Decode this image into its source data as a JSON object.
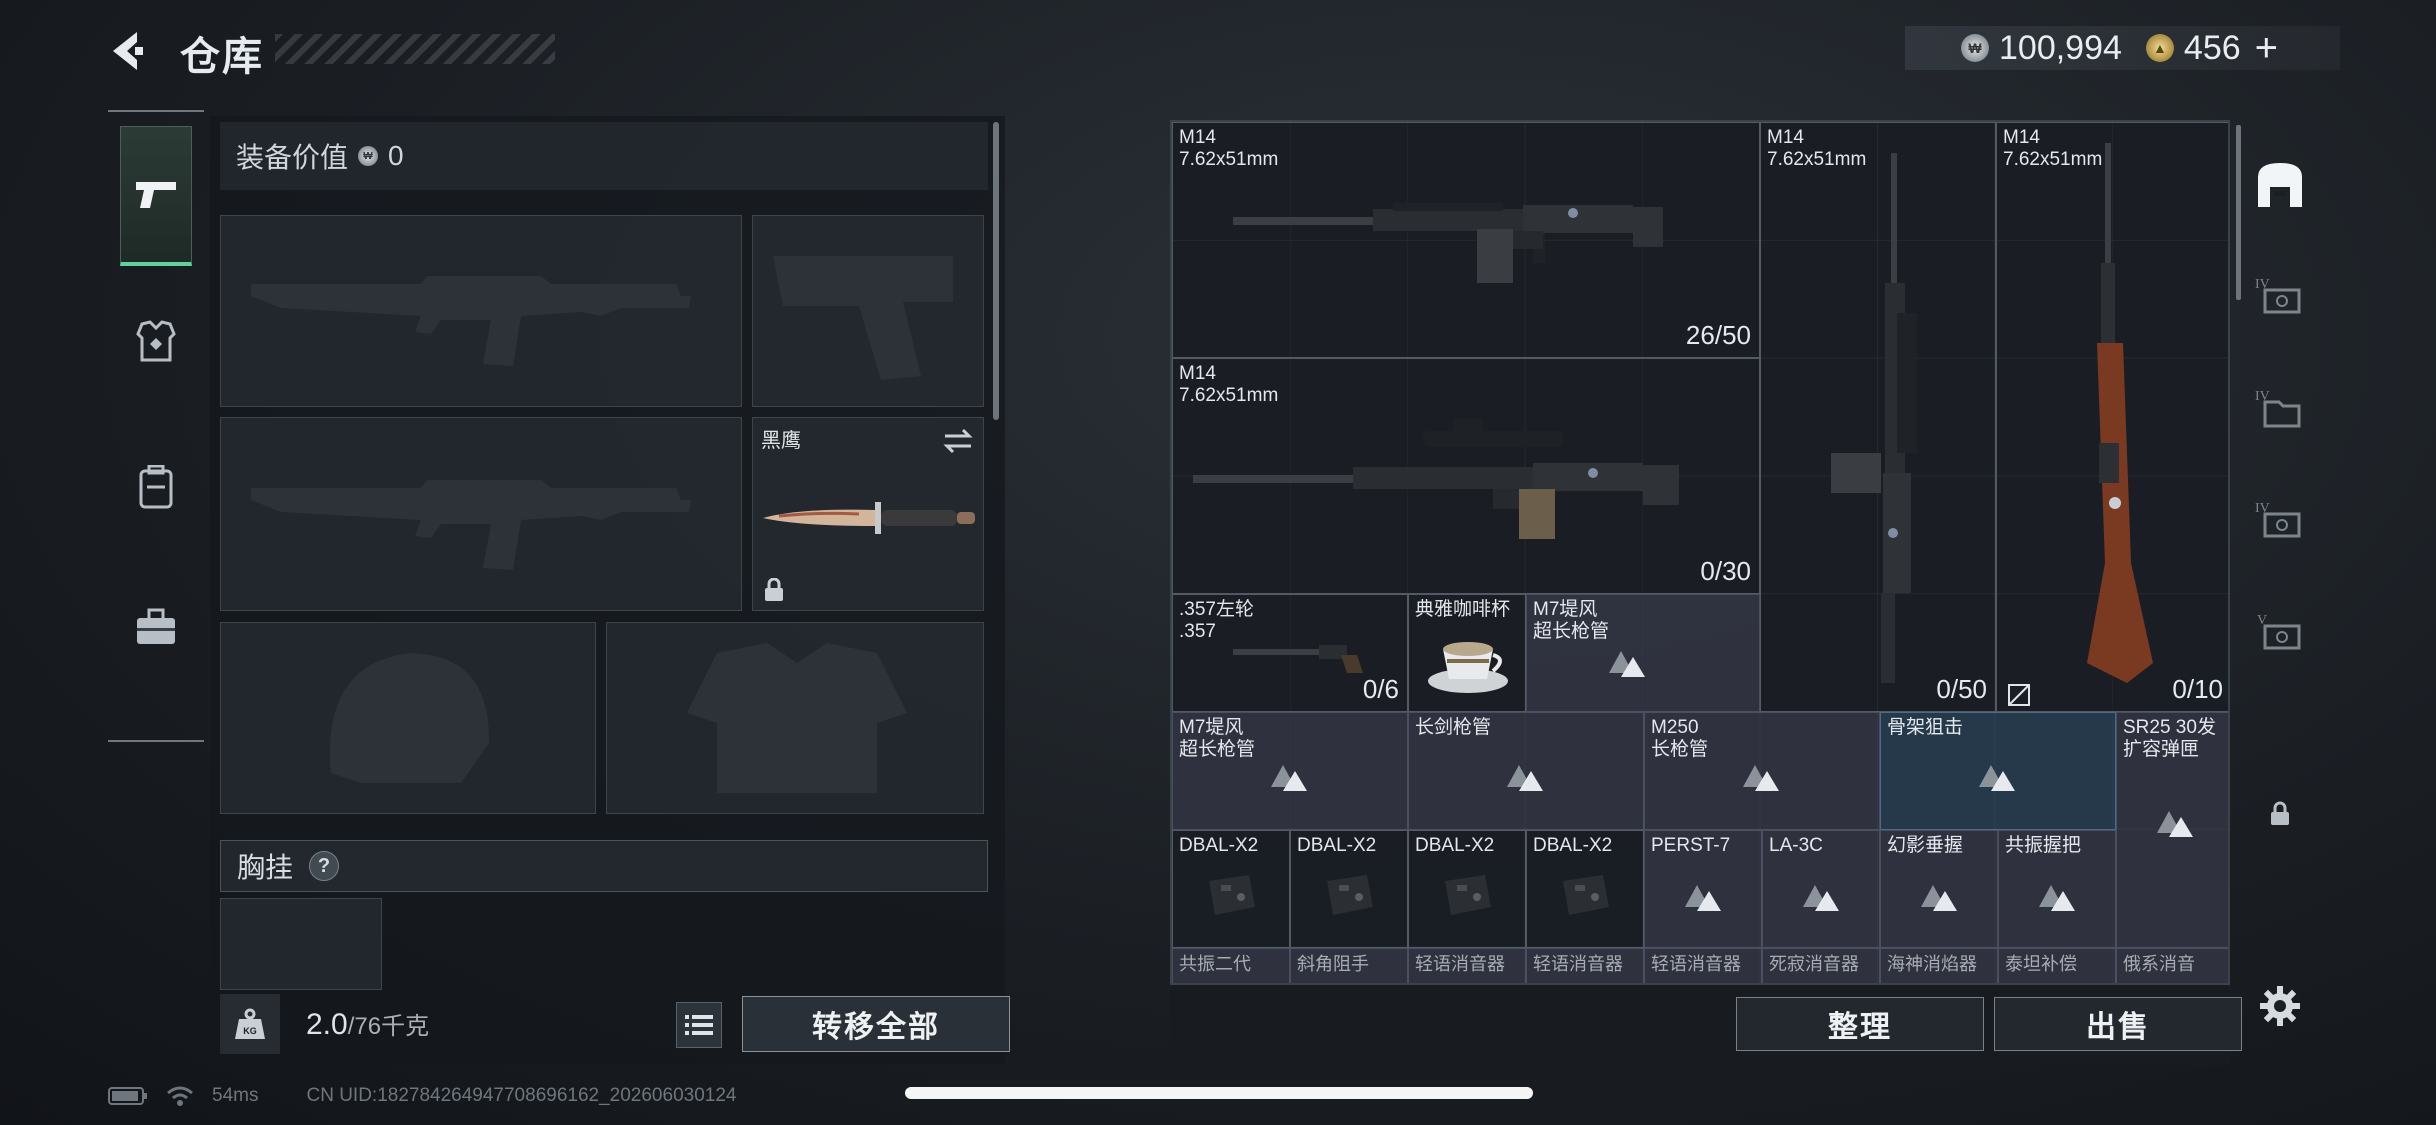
{
  "header": {
    "title": "仓库",
    "silver_amount": "100,994",
    "gold_amount": "456"
  },
  "sidebar": {
    "items": [
      {
        "name": "weapons",
        "active": true
      },
      {
        "name": "armor",
        "active": false
      },
      {
        "name": "backpack",
        "active": false
      },
      {
        "name": "toolbox",
        "active": false
      }
    ]
  },
  "loadout": {
    "equip_value_label": "装备价值",
    "equip_value": "0",
    "melee_label": "黑鹰",
    "chest_rig_label": "胸挂",
    "help_symbol": "?",
    "weight_current": "2.0",
    "weight_max": "/76千克",
    "transfer_all_label": "转移全部",
    "kg_label": "KG"
  },
  "storage": {
    "items": [
      {
        "name": "M14",
        "caliber": "7.62x51mm",
        "count": "26/50"
      },
      {
        "name": "M14",
        "caliber": "7.62x51mm",
        "count": "0/30"
      },
      {
        "name": "M14",
        "caliber": "7.62x51mm",
        "count": "0/50"
      },
      {
        "name": "M14",
        "caliber": "7.62x51mm",
        "count": "0/10"
      },
      {
        "name": ".357左轮",
        "caliber": ".357",
        "count": "0/6"
      },
      {
        "name": "典雅咖啡杯"
      },
      {
        "name": "M7堤风",
        "sub": "超长枪管"
      },
      {
        "name": "M7堤风",
        "sub": "超长枪管"
      },
      {
        "name": "长剑枪管"
      },
      {
        "name": "M250",
        "sub": "长枪管"
      },
      {
        "name": "骨架狙击"
      },
      {
        "name": "SR25 30发",
        "sub": "扩容弹匣"
      },
      {
        "name": "DBAL-X2"
      },
      {
        "name": "DBAL-X2"
      },
      {
        "name": "DBAL-X2"
      },
      {
        "name": "DBAL-X2"
      },
      {
        "name": "PERST-7"
      },
      {
        "name": "LA-3C"
      },
      {
        "name": "幻影垂握"
      },
      {
        "name": "共振握把"
      }
    ],
    "partial_row": [
      "共振二代",
      "斜角阻手",
      "轻语消音器",
      "轻语消音器",
      "轻语消音器",
      "死寂消音器",
      "海神消焰器",
      "泰坦补偿",
      "俄系消音"
    ]
  },
  "actions": {
    "sort_label": "整理",
    "sell_label": "出售"
  },
  "status_bar": {
    "ping": "54ms",
    "uid": "CN UID:18278426494770869616​2_202606030124"
  },
  "colors": {
    "accent_green": "#5fd39c",
    "panel": "#1a1f24",
    "highlight_blue": "#2d4a63"
  }
}
